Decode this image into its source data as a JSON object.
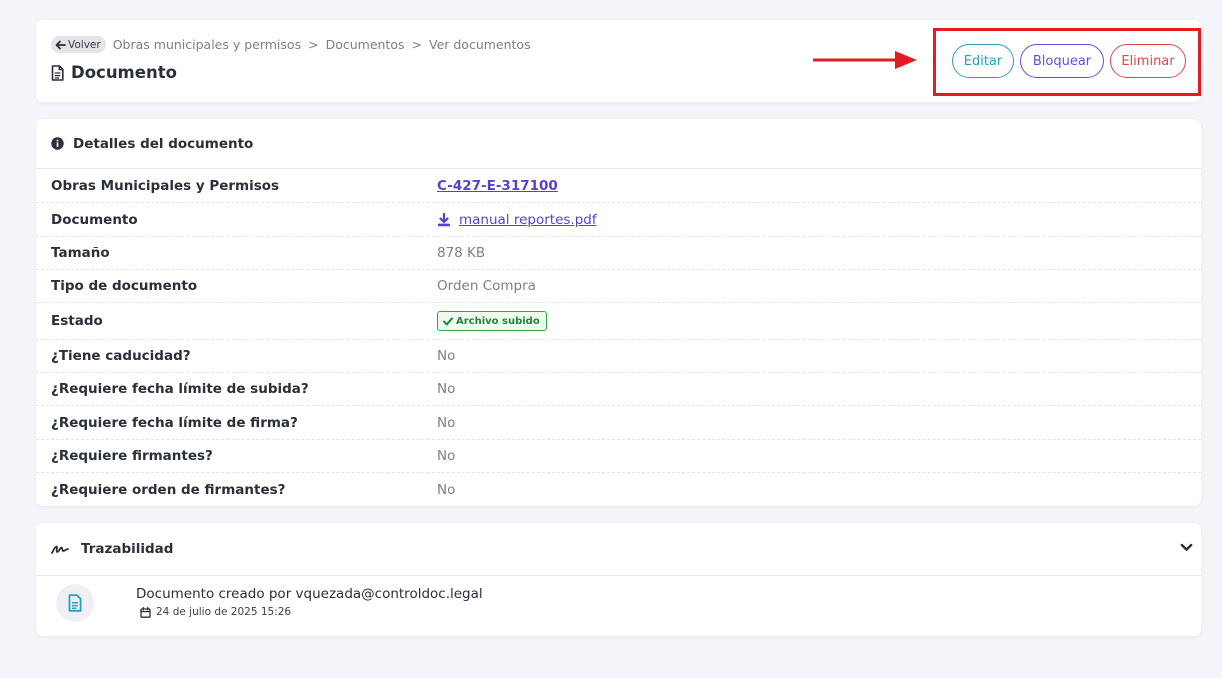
{
  "header": {
    "back_label": "Volver",
    "breadcrumb": [
      "Obras municipales y permisos",
      "Documentos",
      "Ver documentos"
    ],
    "separator": ">",
    "title": "Documento",
    "actions": {
      "edit": "Editar",
      "lock": "Bloquear",
      "delete": "Eliminar"
    }
  },
  "details": {
    "title": "Detalles del documento",
    "rows": [
      {
        "label": "Obras Municipales y Permisos",
        "value": "C-427-E-317100"
      },
      {
        "label": "Documento",
        "value": "manual reportes.pdf"
      },
      {
        "label": "Tamaño",
        "value": "878 KB"
      },
      {
        "label": "Tipo de documento",
        "value": "Orden Compra"
      },
      {
        "label": "Estado",
        "value": "Archivo subido"
      },
      {
        "label": "¿Tiene caducidad?",
        "value": "No"
      },
      {
        "label": "¿Requiere fecha límite de subida?",
        "value": "No"
      },
      {
        "label": "¿Requiere fecha límite de firma?",
        "value": "No"
      },
      {
        "label": "¿Requiere firmantes?",
        "value": "No"
      },
      {
        "label": "¿Requiere orden de firmantes?",
        "value": "No"
      }
    ]
  },
  "traceability": {
    "title": "Trazabilidad",
    "events": [
      {
        "text": "Documento creado por vquezada@controldoc.legal",
        "date": "24 de julio de 2025 15:26"
      }
    ]
  },
  "icons": {
    "back": "arrow-left-icon",
    "page": "file-icon",
    "info": "info-circle-icon",
    "download": "download-icon",
    "check": "check-icon",
    "signature": "signature-icon",
    "chevron": "chevron-down-icon",
    "event": "file-text-icon",
    "calendar": "calendar-icon"
  },
  "colors": {
    "edit": "#2aa0b8",
    "lock": "#6a4bd6",
    "delete": "#e0464f",
    "link": "#5a3fd0",
    "status": "#22863a",
    "annotation": "#e31b23"
  }
}
